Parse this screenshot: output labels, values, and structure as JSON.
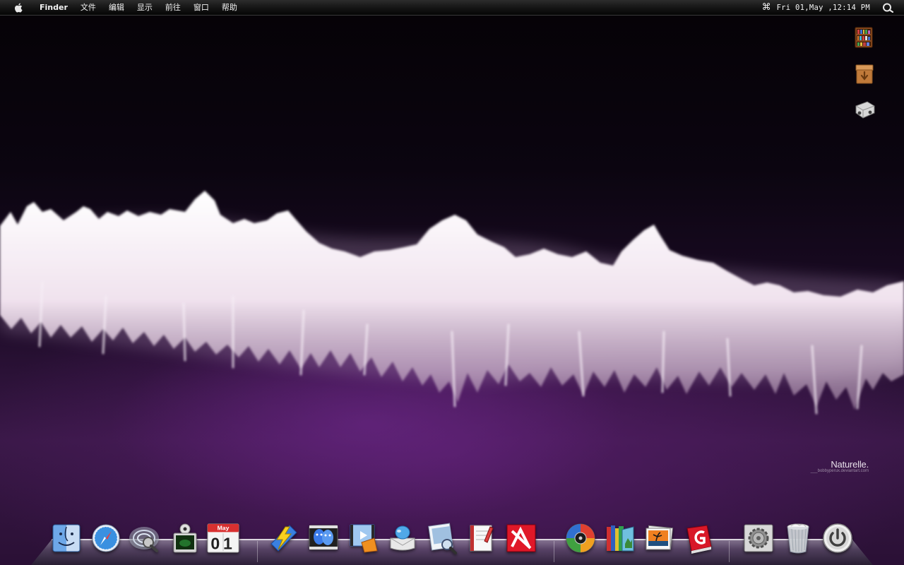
{
  "menubar": {
    "app_name": "Finder",
    "menus": [
      "文件",
      "编辑",
      "显示",
      "前往",
      "窗口",
      "帮助"
    ],
    "command_glyph": "⌘",
    "clock": "Fri 01,May ,12:14 PM"
  },
  "desktop": {
    "icons": [
      "bookshelf-icon",
      "archive-box-icon",
      "hard-drive-icon"
    ]
  },
  "watermark": {
    "title": "Naturelle.",
    "credit": "___bobbyperux.deviantart.com"
  },
  "dock": {
    "calendar": {
      "month": "May",
      "day": "01"
    },
    "items": [
      "finder",
      "safari",
      "quicktime-audio",
      "photo-booth",
      "ical",
      "ftp-app",
      "front-row",
      "imovie",
      "mail-stamp",
      "preview",
      "notes-app",
      "adobe-app",
      "itunes-dvd",
      "books-app",
      "iphoto",
      "dictionary-app",
      "system-preferences",
      "trash",
      "shutdown"
    ]
  },
  "colors": {
    "wallpaper_top": "#050206",
    "wallpaper_bottom": "#3a1848",
    "frost": "#f2e8f0",
    "menubar": "#141414"
  }
}
